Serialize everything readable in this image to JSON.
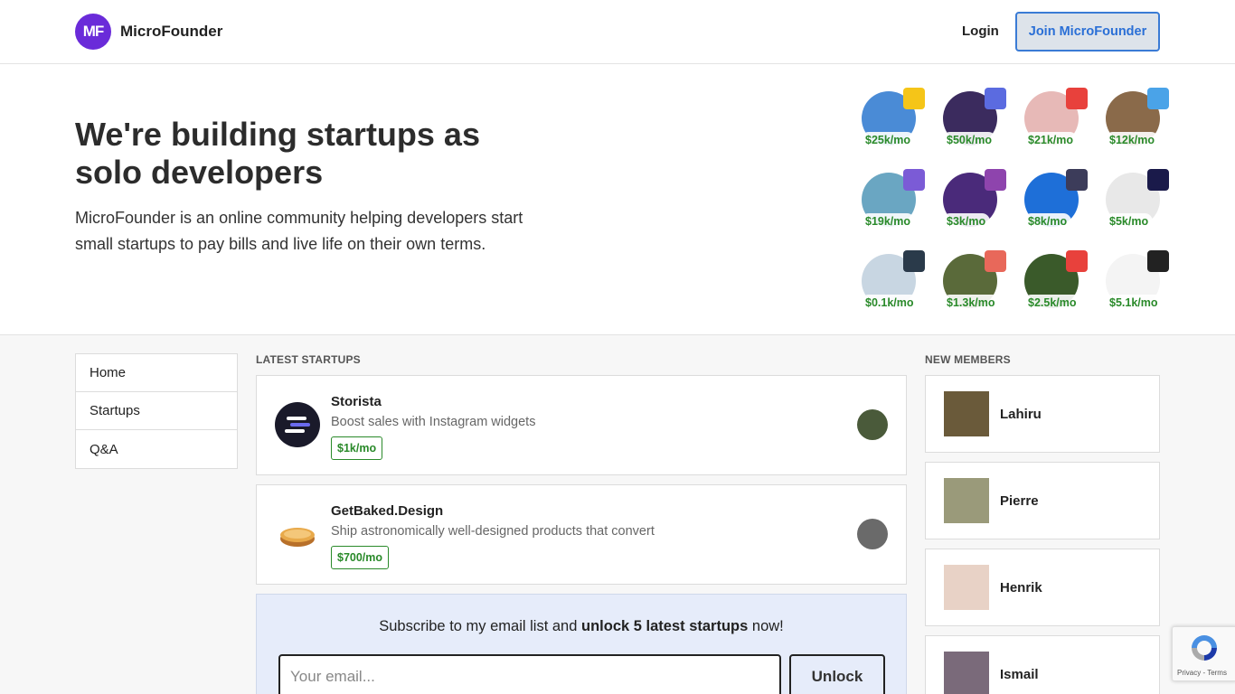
{
  "header": {
    "logo_mark": "MF",
    "brand": "MicroFounder",
    "login": "Login",
    "join": "Join MicroFounder"
  },
  "hero": {
    "title": "We're building startups as solo developers",
    "subtitle": "MicroFounder is an online community helping developers start small startups to pay bills and live life on their own terms."
  },
  "founders": [
    {
      "mrr": "$25k/mo",
      "badge_icon": "bee-icon",
      "color": "#4a8bd6",
      "badge_color": "#f5c518"
    },
    {
      "mrr": "$50k/mo",
      "badge_icon": "chat-bubble-icon",
      "color": "#3b2b5e",
      "badge_color": "#5b6be0"
    },
    {
      "mrr": "$21k/mo",
      "badge_icon": "mail-icon",
      "color": "#e7b9b7",
      "badge_color": "#e8413c"
    },
    {
      "mrr": "$12k/mo",
      "badge_icon": "app-icon",
      "color": "#8a6a4a",
      "badge_color": "#4aa3e8"
    },
    {
      "mrr": "$19k/mo",
      "badge_icon": "planet-icon",
      "color": "#6aa6c2",
      "badge_color": "#7b5bd6"
    },
    {
      "mrr": "$3k/mo",
      "badge_icon": "potion-icon",
      "color": "#4a2a7a",
      "badge_color": "#8e44ad"
    },
    {
      "mrr": "$8k/mo",
      "badge_icon": "monster-icon",
      "color": "#1e6fd8",
      "badge_color": "#3c3c5a"
    },
    {
      "mrr": "$5k/mo",
      "badge_icon": "wave-icon",
      "color": "#e8e8e8",
      "badge_color": "#1a1a4a"
    },
    {
      "mrr": "$0.1k/mo",
      "badge_icon": "mouse-icon",
      "color": "#c8d6e2",
      "badge_color": "#2a3a4a"
    },
    {
      "mrr": "$1.3k/mo",
      "badge_icon": "instagram-icon",
      "color": "#5a6a3a",
      "badge_color": "#e8685a"
    },
    {
      "mrr": "$2.5k/mo",
      "badge_icon": "pie-icon",
      "color": "#3a5a2a",
      "badge_color": "#e8413c"
    },
    {
      "mrr": "$5.1k/mo",
      "badge_icon": "f-icon",
      "color": "#f4f4f4",
      "badge_color": "#222222"
    }
  ],
  "nav": {
    "items": [
      "Home",
      "Startups",
      "Q&A"
    ]
  },
  "startups": {
    "label": "LATEST STARTUPS",
    "items": [
      {
        "name": "Storista",
        "tagline": "Boost sales with Instagram widgets",
        "revenue": "$1k/mo",
        "icon": "storista-logo-icon",
        "icon_color": "#1a1a2a",
        "maker_color": "#4a5a3a"
      },
      {
        "name": "GetBaked.Design",
        "tagline": "Ship astronomically well-designed products that convert",
        "revenue": "$700/mo",
        "icon": "pie-icon",
        "icon_color": "#d99a3a",
        "maker_color": "#6a6a6a"
      }
    ]
  },
  "subscribe": {
    "text_before": "Subscribe to my email list and ",
    "text_bold": "unlock 5 latest startups",
    "text_after": " now!",
    "placeholder": "Your email...",
    "button": "Unlock"
  },
  "members": {
    "label": "NEW MEMBERS",
    "items": [
      {
        "name": "Lahiru",
        "color": "#6a5a3a"
      },
      {
        "name": "Pierre",
        "color": "#9a9a7a"
      },
      {
        "name": "Henrik",
        "color": "#e8d2c6"
      },
      {
        "name": "Ismail",
        "color": "#7a6a7a"
      }
    ]
  },
  "recaptcha": {
    "links": "Privacy - Terms"
  }
}
